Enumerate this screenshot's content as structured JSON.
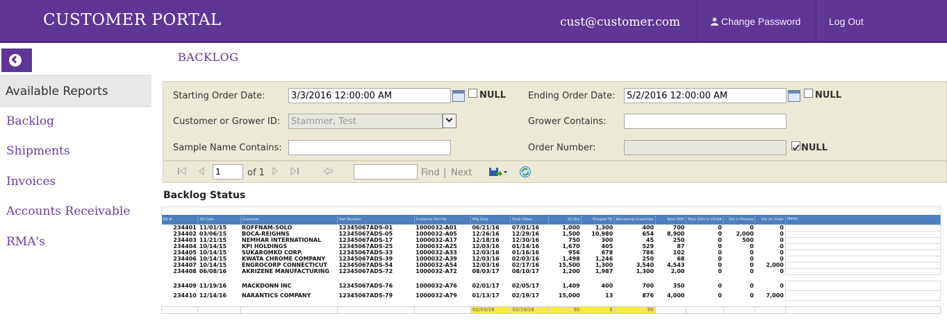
{
  "header": {
    "brand": "CUSTOMER PORTAL",
    "email": "cust@customer.com",
    "change_password": "Change Password",
    "logout": "Log Out"
  },
  "sidebar": {
    "section_label": "Available Reports",
    "items": [
      {
        "label": "Backlog"
      },
      {
        "label": "Shipments"
      },
      {
        "label": "Invoices"
      },
      {
        "label": "Accounts Receivable"
      },
      {
        "label": "RMA's"
      }
    ]
  },
  "page": {
    "title": "BACKLOG"
  },
  "params": {
    "starting_order_date_label": "Starting Order Date:",
    "starting_order_date_value": "3/3/2016 12:00:00 AM",
    "ending_order_date_label": "Ending Order Date:",
    "ending_order_date_value": "5/2/2016 12:00:00 AM",
    "null_label": "NULL",
    "customer_label": "Customer or Grower ID:",
    "customer_value": "Stammer, Test",
    "grower_contains_label": "Grower Contains:",
    "grower_contains_value": "",
    "sample_name_label": "Sample Name Contains:",
    "sample_name_value": "",
    "order_number_label": "Order Number:",
    "order_number_value": "",
    "order_number_null_checked": true
  },
  "toolbar": {
    "page_value": "1",
    "of_label": "of 1",
    "find_label": "Find",
    "separator": "|",
    "next_label": "Next",
    "find_value": ""
  },
  "report": {
    "title": "Backlog Status",
    "columns": [
      "SO #",
      "SO Date",
      "Customer",
      "Part Number",
      "Customer Part No",
      "Mfg Date",
      "Book Dates",
      "SO Qty",
      "Shipped TD",
      "Remaining Quantities",
      "Total QOH",
      "Total QOH in CR/QA",
      "Qty in Process",
      "Qty on Order",
      "Memo"
    ],
    "rows": [
      [
        "234401",
        "11/01/15",
        "ROFFNAM-SOLO",
        "12345067ADS-01",
        "1000032-A01",
        "06/21/16",
        "07/01/16",
        "1,000",
        "1,300",
        "400",
        "700",
        "0",
        "0",
        "0",
        ""
      ],
      [
        "234402",
        "03/06/15",
        "BOCA-REIGHNS",
        "12345067ADS-05",
        "1000032-A05",
        "12/26/16",
        "12/29/16",
        "1,500",
        "10,980",
        "654",
        "8,900",
        "0",
        "2,000",
        "0",
        ""
      ],
      [
        "234403",
        "11/21/15",
        "NEMHAR INTERNATIONAL",
        "12345067ADS-17",
        "1000032-A17",
        "12/18/16",
        "12/30/16",
        "750",
        "300",
        "45",
        "250",
        "0",
        "500",
        "0",
        ""
      ],
      [
        "234404",
        "10/14/15",
        "KPI HOLDINGS",
        "12345067ADS-25",
        "1000032-A25",
        "12/03/16",
        "01/14/16",
        "1,670",
        "405",
        "529",
        "87",
        "0",
        "0",
        "0",
        ""
      ],
      [
        "234405",
        "10/14/15",
        "SUKAROMKO CORP.",
        "12345067ADS-33",
        "1000032-A33",
        "12/03/16",
        "01/16/16",
        "956",
        "678",
        "786",
        "102",
        "0",
        "0",
        "0",
        ""
      ],
      [
        "234406",
        "10/14/15",
        "KWATA CHROME COMPANY",
        "12345067ADS-39",
        "1000032-A39",
        "12/03/16",
        "02/03/16",
        "1,498",
        "1,246",
        "250",
        "68",
        "0",
        "0",
        "0",
        ""
      ],
      [
        "234407",
        "10/14/15",
        "ENGROCORP CONNECTICUT",
        "12345067ADS-54",
        "1000032-A54",
        "12/03/16",
        "02/17/16",
        "15,500",
        "1,300",
        "3,540",
        "4,543",
        "0",
        "0",
        "2,000",
        ""
      ],
      [
        "234408",
        "06/08/16",
        "AKRIZENE MANUFACTURING",
        "12345067ADS-72",
        "1000032-A72",
        "08/03/17",
        "08/10/17",
        "1,200",
        "1,987",
        "1,300",
        "2,00",
        "0",
        "0",
        "0",
        ""
      ],
      [
        "234409",
        "11/19/16",
        "MACKDONN INC",
        "12345067ADS-76",
        "1000032-A76",
        "02/01/17",
        "02/05/17",
        "1,409",
        "400",
        "700",
        "350",
        "0",
        "0",
        "0",
        ""
      ],
      [
        "234410",
        "12/14/16",
        "NARANTICS COMPANY",
        "12345067ADS-79",
        "1000032-A79",
        "01/13/17",
        "02/19/17",
        "15,000",
        "13",
        "876",
        "4,000",
        "0",
        "0",
        "7,000",
        ""
      ]
    ],
    "totals": [
      "",
      "",
      "",
      "",
      "",
      "02/03/16",
      "02/19/16",
      "50",
      "0",
      "50",
      "",
      "",
      "",
      "",
      ""
    ]
  },
  "colors": {
    "brand": "#5f3696",
    "params_bg": "#ece9d8",
    "grid_header": "#4f7fc0",
    "highlight": "#f4ee3a"
  },
  "icons": [
    "back-arrow-icon",
    "user-icon",
    "calendar-icon",
    "first-page-icon",
    "prev-page-icon",
    "next-page-icon",
    "last-page-icon",
    "back-icon",
    "export-icon",
    "refresh-icon"
  ]
}
